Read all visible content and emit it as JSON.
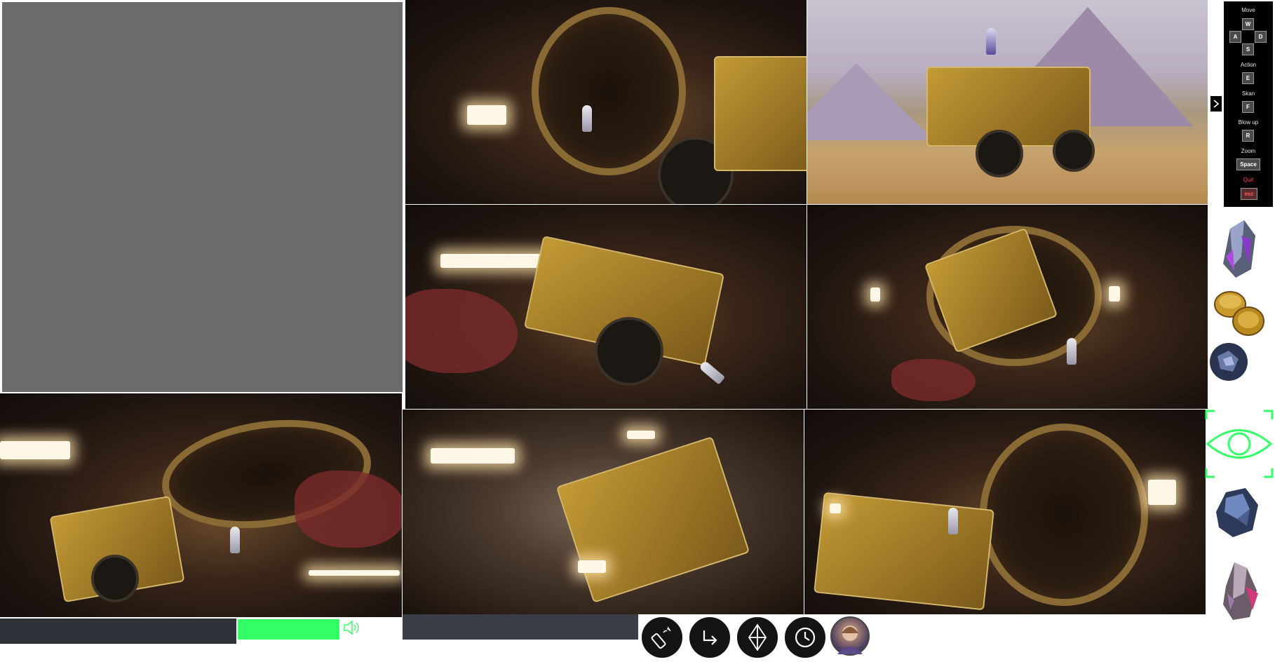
{
  "colors": {
    "placeholder_gray": "#6b6b6b",
    "bar_dark": "#2f3138",
    "bar_green": "#33ff66",
    "eye_green": "#33ff66",
    "quit_red": "#ff4040"
  },
  "gallery": {
    "scenes": [
      {
        "name": "astronaut-at-tunnel-mouth",
        "kind": "cave"
      },
      {
        "name": "astronaut-on-rover-desert",
        "kind": "desert"
      },
      {
        "name": "rover-tipping-cave",
        "kind": "cave"
      },
      {
        "name": "rover-entering-tunnel",
        "kind": "cave"
      },
      {
        "name": "rover-and-astronaut-cave",
        "kind": "cave"
      },
      {
        "name": "rover-driving-dust",
        "kind": "cave"
      },
      {
        "name": "rover-at-glowing-tunnel",
        "kind": "cave"
      }
    ]
  },
  "status": {
    "progress": 1.0
  },
  "toolbar": {
    "buttons": [
      {
        "name": "dynamite-button",
        "icon": "dynamite-icon"
      },
      {
        "name": "turn-right-button",
        "icon": "turn-right-arrow-icon"
      },
      {
        "name": "crystal-button",
        "icon": "crystal-icon"
      },
      {
        "name": "clock-button",
        "icon": "clock-icon"
      }
    ],
    "avatar_icon": "astronaut-avatar"
  },
  "controls": {
    "move_label": "Move",
    "w": "W",
    "a": "A",
    "d": "D",
    "s": "S",
    "action_label": "Action",
    "e": "E",
    "skan_label": "Skan",
    "f": "F",
    "blowup_label": "Blow up",
    "r": "R",
    "zoom_label": "Zoom",
    "space": "Space",
    "quit_label": "Quit",
    "esc": "esc"
  },
  "inventory": {
    "items": [
      {
        "name": "purple-crystal-item",
        "icon": "purple-crystal-icon"
      },
      {
        "name": "fuel-barrels-item",
        "icon": "fuel-barrels-icon"
      },
      {
        "name": "blue-orb-item",
        "icon": "blue-orb-icon"
      },
      {
        "name": "scan-eye-item",
        "icon": "eye-icon"
      },
      {
        "name": "blue-ore-item",
        "icon": "blue-ore-icon"
      },
      {
        "name": "pink-crystal-item",
        "icon": "pink-crystal-icon"
      }
    ]
  }
}
